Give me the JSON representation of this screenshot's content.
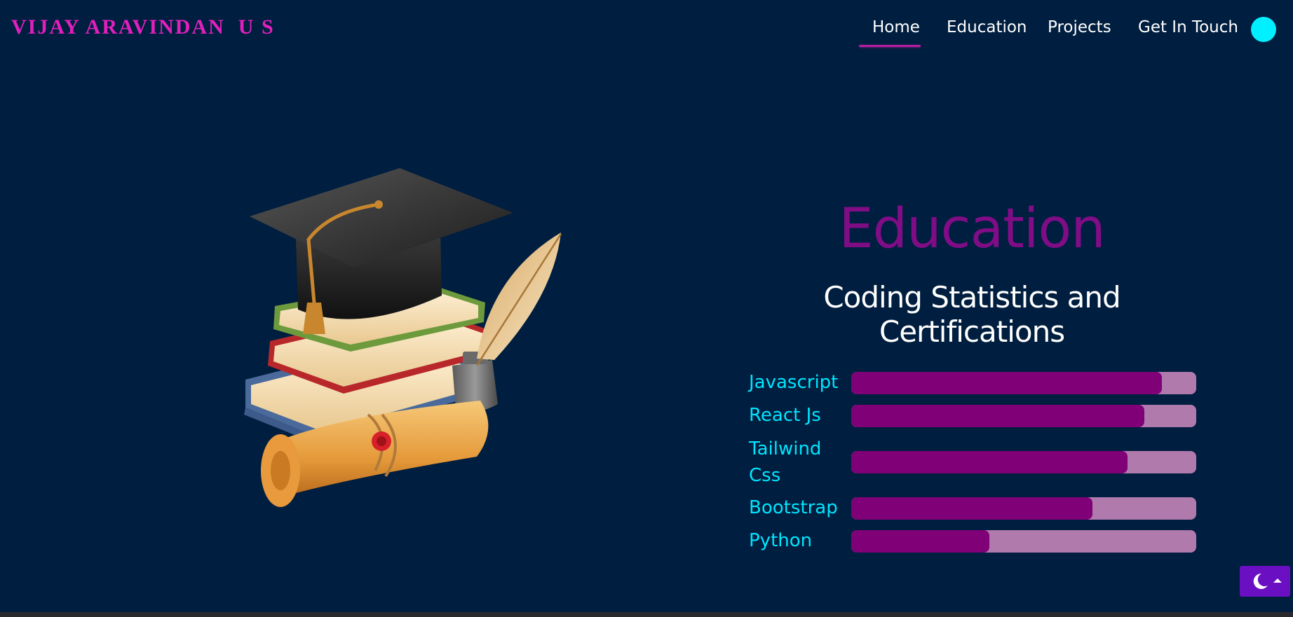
{
  "header": {
    "brand": "VIJAY ARAVINDAN  U S",
    "nav": {
      "home": "Home",
      "education": "Education",
      "projects": "Projects",
      "contact": "Get In Touch"
    },
    "active_nav": "Home"
  },
  "hero": {
    "title": "Education",
    "subtitle": "Coding Statistics and Certifications"
  },
  "skills": [
    {
      "label": "Javascript",
      "level": 0.9
    },
    {
      "label": "React Js",
      "level": 0.85
    },
    {
      "label": "Tailwind Css",
      "level": 0.8
    },
    {
      "label": "Bootstrap",
      "level": 0.7
    },
    {
      "label": "Python",
      "level": 0.4
    }
  ],
  "colors": {
    "background": "#001e3f",
    "brand": "#e21fbd",
    "title": "#800c86",
    "skill_label": "#00e5ff",
    "bar_fill": "#800078",
    "bar_track": "#b07aad",
    "theme_dot": "#00f0ff",
    "fab": "#6a0fc2"
  },
  "icons": {
    "illustration": "education-illustration-icon",
    "fab_moon": "moon-icon",
    "fab_caret": "caret-up-icon",
    "theme_toggle": "theme-dot-icon"
  }
}
